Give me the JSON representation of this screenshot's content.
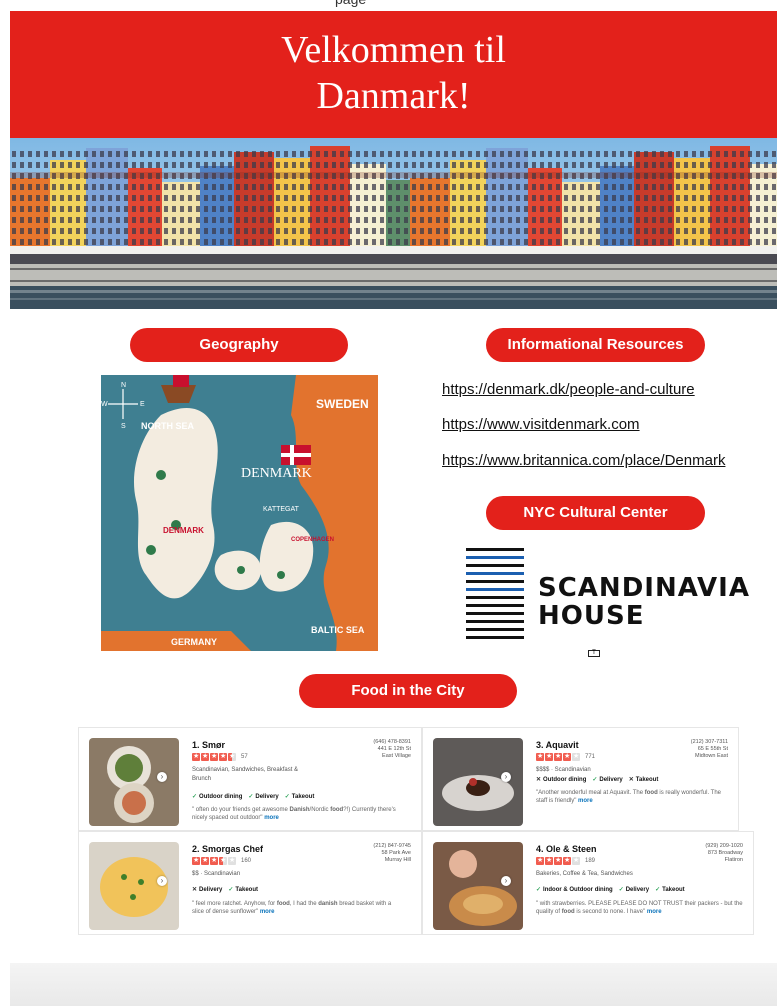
{
  "page": {
    "cut_title": "page"
  },
  "banner": {
    "line1": "Velkommen til",
    "line2": "Danmark!"
  },
  "sections": {
    "geography": "Geography",
    "resources": "Informational Resources",
    "cultural": "NYC Cultural Center",
    "food": "Food in the City"
  },
  "map": {
    "labels": {
      "north_sea": "NORTH SEA",
      "sweden": "SWEDEN",
      "denmark_big": "DENMARK",
      "denmark_small": "DENMARK",
      "kattegat": "KATTEGAT",
      "copenhagen": "COPENHAGEN",
      "baltic": "BALTIC SEA",
      "germany": "GERMANY",
      "compass_n": "N",
      "compass_s": "S",
      "compass_e": "E",
      "compass_w": "W"
    }
  },
  "links": [
    "https://denmark.dk/people-and-culture",
    "https://www.visitdenmark.com",
    "https://www.britannica.com/place/Denmark"
  ],
  "logo": {
    "line1": "SCANDINAVIA",
    "line2": "HOUSE"
  },
  "restaurants": [
    {
      "name": "1. Smør",
      "phone": "(646) 478-8391",
      "addr1": "441 E 12th St",
      "addr2": "East Village",
      "rating": 4.5,
      "review_count": "57",
      "categories": "Scandinavian, Sandwiches, Breakfast & Brunch",
      "features": [
        {
          "ok": true,
          "label": "Outdoor dining"
        },
        {
          "ok": true,
          "label": "Delivery"
        },
        {
          "ok": true,
          "label": "Takeout"
        }
      ],
      "quote_pre": "\" often do your friends get awesome ",
      "quote_b1": "Danish",
      "quote_mid": "/Nordic ",
      "quote_b2": "food",
      "quote_post": "?!) Currently there's nicely spaced out outdoor\" ",
      "more": "more"
    },
    {
      "name": "3. Aquavit",
      "phone": "(212) 307-7311",
      "addr1": "65 E 55th St",
      "addr2": "Midtown East",
      "rating": 4,
      "review_count": "771",
      "categories": "$$$$ · Scandinavian",
      "features": [
        {
          "ok": false,
          "label": "Outdoor dining"
        },
        {
          "ok": true,
          "label": "Delivery"
        },
        {
          "ok": false,
          "label": "Takeout"
        }
      ],
      "quote_pre": "\"Another wonderful meal at Aquavit. The ",
      "quote_b1": "food",
      "quote_mid": " is really wonderful. The staff is friendly\" ",
      "quote_b2": "",
      "quote_post": "",
      "more": "more"
    },
    {
      "name": "2. Smorgas Chef",
      "phone": "(212) 847-9745",
      "addr1": "58 Park Ave",
      "addr2": "Murray Hill",
      "rating": 3.5,
      "review_count": "160",
      "categories": "$$ · Scandinavian",
      "features": [
        {
          "ok": false,
          "label": "Delivery"
        },
        {
          "ok": true,
          "label": "Takeout"
        }
      ],
      "quote_pre": "\" feel more ratchet. Anyhow, for ",
      "quote_b1": "food",
      "quote_mid": ", I had the ",
      "quote_b2": "danish",
      "quote_post": " bread basket with a slice of dense sunflower\" ",
      "more": "more"
    },
    {
      "name": "4. Ole & Steen",
      "phone": "(929) 209-1020",
      "addr1": "873 Broadway",
      "addr2": "Flatiron",
      "rating": 4,
      "review_count": "189",
      "categories": "Bakeries, Coffee & Tea, Sandwiches",
      "features": [
        {
          "ok": true,
          "label": "Indoor & Outdoor dining"
        },
        {
          "ok": true,
          "label": "Delivery"
        },
        {
          "ok": true,
          "label": "Takeout"
        }
      ],
      "quote_pre": "\" with strawberries. PLEASE PLEASE DO NOT TRUST their packers - but the quality of ",
      "quote_b1": "food",
      "quote_mid": " is second to none. I have\" ",
      "quote_b2": "",
      "quote_post": "",
      "more": "more"
    }
  ],
  "colors": {
    "brand_red": "#e3211b",
    "link_blue": "#0a73bb",
    "yelp_star": "#f15c4f",
    "check_green": "#2ea45a"
  }
}
